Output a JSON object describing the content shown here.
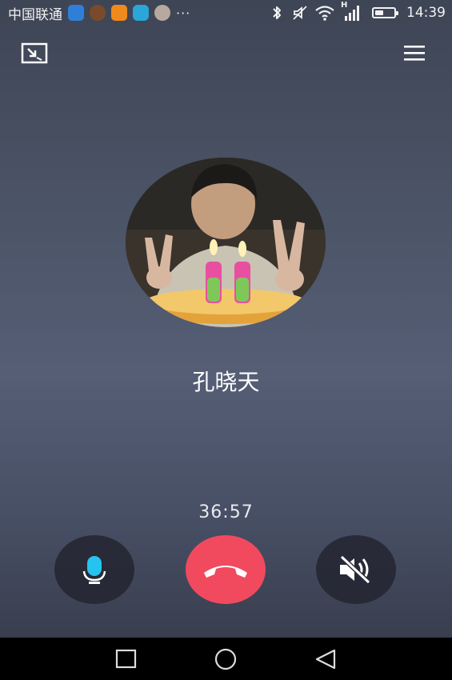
{
  "status_bar": {
    "carrier": "中国联通",
    "overflow": "···",
    "time": "14:39",
    "network_label": "H",
    "battery_level": 0.45,
    "icons": [
      "app-icon-1",
      "app-icon-2",
      "app-icon-3",
      "app-icon-4",
      "app-icon-5",
      "bluetooth-icon",
      "silent-icon",
      "wifi-icon",
      "signal-icon",
      "battery-icon"
    ]
  },
  "top_bar": {
    "left_icon": "minimize-window-icon",
    "right_icon": "menu-icon"
  },
  "call": {
    "contact_name": "孔晓天",
    "duration": "36:57",
    "avatar_icon": "contact-avatar-photo"
  },
  "controls": {
    "mic_icon": "microphone-icon",
    "hangup_icon": "hangup-phone-icon",
    "speaker_icon": "speaker-muted-icon"
  },
  "colors": {
    "hangup": "#f14a5f",
    "mic_accent": "#27c3ef",
    "control_bg": "#232630"
  },
  "nav_bar": {
    "icons": [
      "recent-apps-icon",
      "home-icon",
      "back-icon"
    ]
  }
}
